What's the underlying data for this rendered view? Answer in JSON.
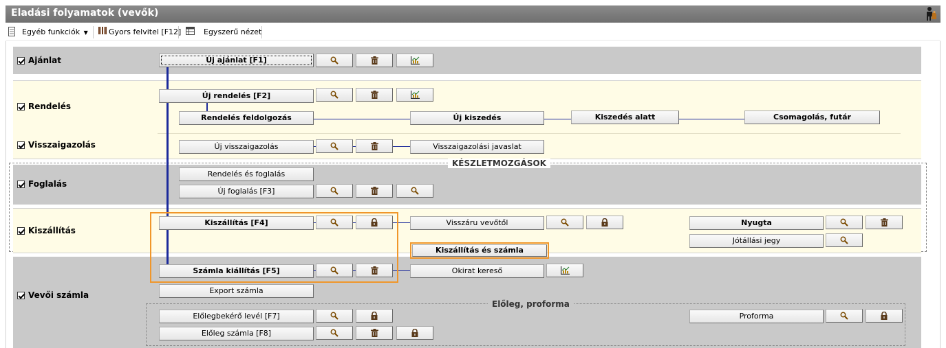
{
  "window": {
    "title": "Eladási folyamatok (vevők)"
  },
  "toolbar": {
    "other_functions": "Egyéb funkciók",
    "quick_entry": "Gyors felvitel [F12]",
    "simple_view": "Egyszerű nézet"
  },
  "sections": {
    "offer": "Ajánlat",
    "order": "Rendelés",
    "confirmation": "Visszaigazolás",
    "reservation": "Foglalás",
    "delivery": "Kiszállítás",
    "invoice": "Vevői számla"
  },
  "buttons": {
    "new_offer": "Új ajánlat [F1]",
    "new_order": "Új rendelés [F2]",
    "order_processing": "Rendelés feldolgozás",
    "new_picking": "Új kiszedés",
    "picking_in_progress": "Kiszedés alatt",
    "packing_courier": "Csomagolás, futár",
    "new_confirmation": "Új visszaigazolás",
    "confirmation_proposal": "Visszaigazolási javaslat",
    "order_and_reservation": "Rendelés és foglalás",
    "new_reservation": "Új foglalás [F3]",
    "delivery": "Kiszállítás [F4]",
    "customer_return": "Visszáru vevőtől",
    "receipt": "Nyugta",
    "warranty_card": "Jótállási jegy",
    "delivery_and_invoice": "Kiszállítás és számla",
    "issue_invoice": "Számla kiállítás [F5]",
    "document_search": "Okirat kereső",
    "export_invoice": "Export számla",
    "prepayment_request": "Előlegbekérő levél [F7]",
    "prepayment_invoice": "Előleg számla [F8]",
    "proforma": "Proforma"
  },
  "groups": {
    "stock_movements": "KÉSZLETMOZGÁSOK",
    "prepayment_proforma": "Előleg, proforma"
  },
  "colors": {
    "accent_line": "#1c2a9b",
    "highlight": "#f0962a",
    "gray_band": "#c9c9c9",
    "cream_band": "#fffce6"
  }
}
